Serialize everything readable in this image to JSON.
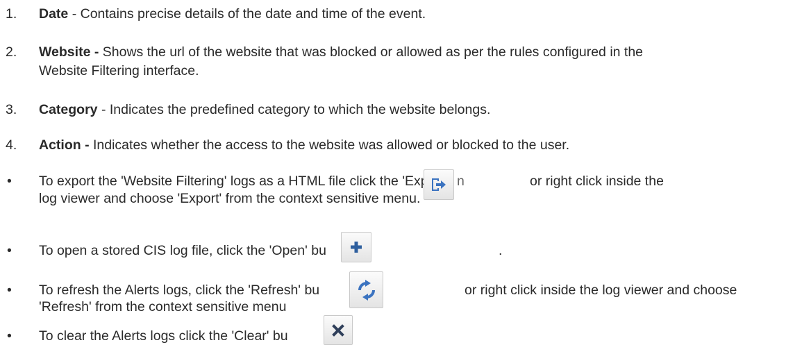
{
  "items": [
    {
      "marker": "1.",
      "term": "Date",
      "text": " - Contains precise details of the date and time of the event."
    },
    {
      "marker": "2.",
      "term": "Website -",
      "line1": " Shows the url of the website that was blocked or allowed as per the rules configured in the",
      "line2": "Website Filtering interface."
    },
    {
      "marker": "3.",
      "term": "Category",
      "text": " - Indicates the predefined category to which the website belongs."
    },
    {
      "marker": "4.",
      "term": "Action -",
      "text": " Indicates whether the access to the website was allowed or blocked to the user."
    }
  ],
  "bullets": [
    {
      "marker": "•",
      "line1a": "To export the 'Website Filtering' logs as a HTML file click the 'Export'",
      "line1b": "n",
      "line1c": "or right click inside the",
      "line2": "log viewer and choose 'Export' from the context sensitive menu."
    },
    {
      "marker": "•",
      "line1a": "To open a stored CIS log file, click the 'Open' bu",
      "line1c": "."
    },
    {
      "marker": "•",
      "line1a": "To refresh the Alerts logs, click the 'Refresh' bu",
      "line1c": "or right click inside the log viewer and choose",
      "line2": "'Refresh' from the context sensitive menu"
    },
    {
      "marker": "•",
      "line1a": "To clear the Alerts logs click the 'Clear' bu"
    }
  ],
  "icons": {
    "export": "export-icon",
    "open": "plus-icon",
    "refresh": "refresh-icon",
    "clear": "close-icon"
  }
}
